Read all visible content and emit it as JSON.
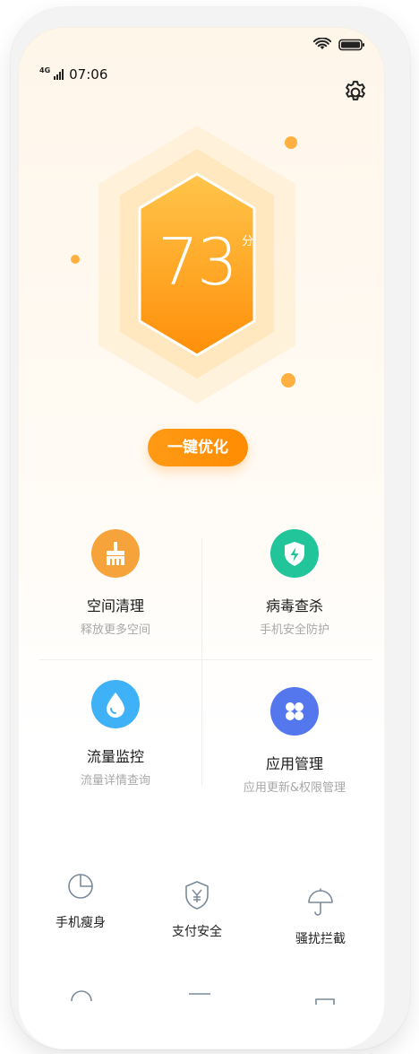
{
  "status_bar": {
    "network": "4G",
    "time": "07:06"
  },
  "header": {
    "settings_icon": "gear-icon"
  },
  "score": {
    "value": "73",
    "unit": "分"
  },
  "optimize_button": {
    "label": "一键优化"
  },
  "features": [
    {
      "title": "空间清理",
      "subtitle": "释放更多空间",
      "icon": "broom-icon",
      "color": "#f5a33a"
    },
    {
      "title": "病毒查杀",
      "subtitle": "手机安全防护",
      "icon": "shield-bolt-icon",
      "color": "#22c59a"
    },
    {
      "title": "流量监控",
      "subtitle": "流量详情查询",
      "icon": "water-drop-icon",
      "color": "#3fb1f7"
    },
    {
      "title": "应用管理",
      "subtitle": "应用更新&权限管理",
      "icon": "apps-grid-icon",
      "color": "#5577ee"
    }
  ],
  "tools": [
    {
      "label": "手机瘦身",
      "icon": "pie-chart-icon"
    },
    {
      "label": "支付安全",
      "icon": "shield-yuan-icon"
    },
    {
      "label": "骚扰拦截",
      "icon": "umbrella-icon"
    }
  ]
}
